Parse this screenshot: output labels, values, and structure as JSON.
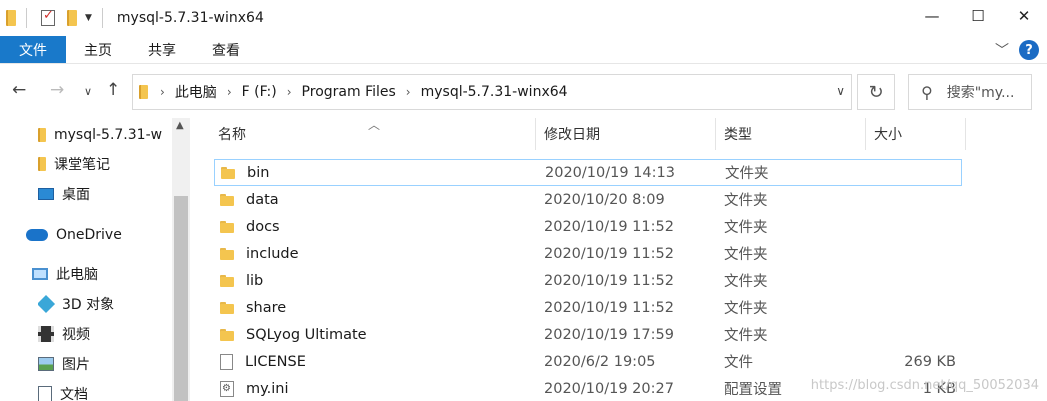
{
  "window": {
    "title": "mysql-5.7.31-winx64",
    "minimize": "—",
    "maximize": "☐",
    "close": "✕"
  },
  "ribbon": {
    "tabs": [
      "文件",
      "主页",
      "共享",
      "查看"
    ]
  },
  "address": {
    "crumbs": [
      "此电脑",
      "F (F:)",
      "Program Files",
      "mysql-5.7.31-winx64"
    ],
    "search_placeholder": "搜索\"my..."
  },
  "nav": {
    "items": [
      {
        "label": "mysql-5.7.31-w",
        "icon": "folder-icon"
      },
      {
        "label": "课堂笔记",
        "icon": "folder-icon"
      },
      {
        "label": "桌面",
        "icon": "desktop-icon"
      },
      {
        "label": "OneDrive",
        "icon": "cloud-icon"
      },
      {
        "label": "此电脑",
        "icon": "this-pc-icon"
      },
      {
        "label": "3D 对象",
        "icon": "cube-icon"
      },
      {
        "label": "视频",
        "icon": "video-icon"
      },
      {
        "label": "图片",
        "icon": "picture-icon"
      },
      {
        "label": "文档",
        "icon": "document-icon"
      }
    ]
  },
  "columns": {
    "name": "名称",
    "date": "修改日期",
    "type": "类型",
    "size": "大小"
  },
  "files": [
    {
      "name": "bin",
      "date": "2020/10/19 14:13",
      "type": "文件夹",
      "size": "",
      "icon": "folder"
    },
    {
      "name": "data",
      "date": "2020/10/20 8:09",
      "type": "文件夹",
      "size": "",
      "icon": "folder"
    },
    {
      "name": "docs",
      "date": "2020/10/19 11:52",
      "type": "文件夹",
      "size": "",
      "icon": "folder"
    },
    {
      "name": "include",
      "date": "2020/10/19 11:52",
      "type": "文件夹",
      "size": "",
      "icon": "folder"
    },
    {
      "name": "lib",
      "date": "2020/10/19 11:52",
      "type": "文件夹",
      "size": "",
      "icon": "folder"
    },
    {
      "name": "share",
      "date": "2020/10/19 11:52",
      "type": "文件夹",
      "size": "",
      "icon": "folder"
    },
    {
      "name": "SQLyog Ultimate",
      "date": "2020/10/19 17:59",
      "type": "文件夹",
      "size": "",
      "icon": "folder"
    },
    {
      "name": "LICENSE",
      "date": "2020/6/2 19:05",
      "type": "文件",
      "size": "269 KB",
      "icon": "file"
    },
    {
      "name": "my.ini",
      "date": "2020/10/19 20:27",
      "type": "配置设置",
      "size": "1 KB",
      "icon": "config"
    }
  ],
  "watermark": "https://blog.csdn.net/qq_50052034"
}
